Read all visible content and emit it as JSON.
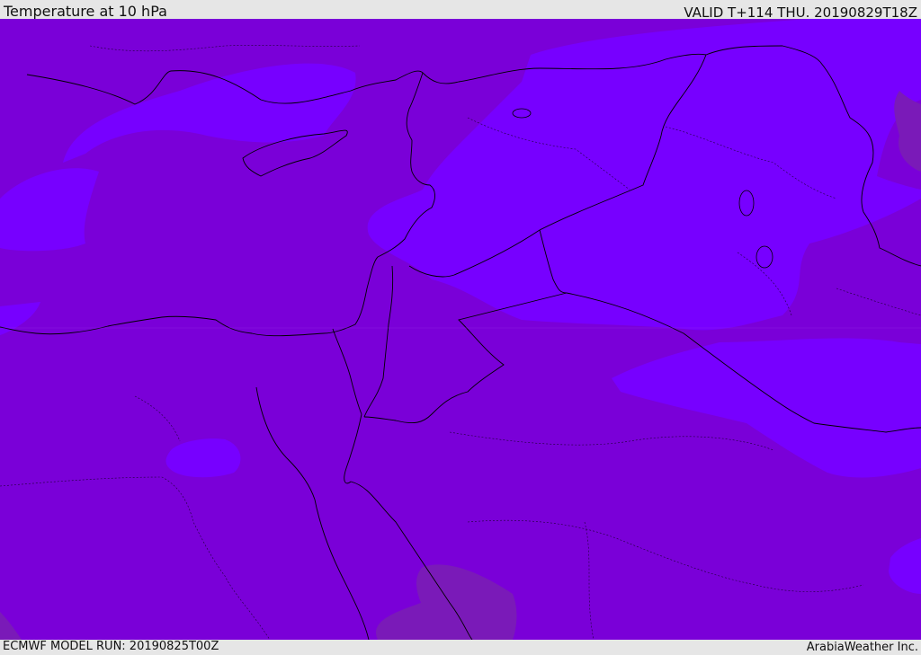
{
  "header": {
    "title": "Temperature at 10 hPa",
    "valid_time": "VALID T+114 THU. 20190829T18Z"
  },
  "footer": {
    "model_run": "ECMWF MODEL RUN: 20190825T00Z",
    "credit": "ArabiaWeather Inc."
  },
  "map": {
    "field": "temperature",
    "level_hpa": 10,
    "colors": {
      "base_shade": "#7a00d8",
      "warmer_shade": "#7700ff",
      "cooler_shade": "#7a1ab8",
      "border_line": "#000000"
    }
  }
}
